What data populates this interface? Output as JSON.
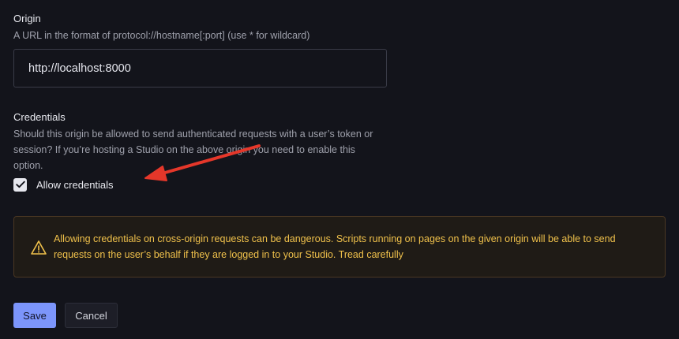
{
  "origin": {
    "label": "Origin",
    "help": "A URL in the format of protocol://hostname[:port] (use * for wildcard)",
    "value": "http://localhost:8000"
  },
  "credentials": {
    "label": "Credentials",
    "help": "Should this origin be allowed to send authenticated requests with a user’s token or session? If you’re hosting a Studio on the above origin you need to enable this option.",
    "checkbox_label": "Allow credentials",
    "checked": true
  },
  "warning": {
    "icon": "warning-triangle-icon",
    "text": "Allowing credentials on cross-origin requests can be dangerous. Scripts running on pages on the given origin will be able to send requests on the user’s behalf if they are logged in to your Studio. Tread carefully"
  },
  "actions": {
    "save_label": "Save",
    "cancel_label": "Cancel"
  },
  "colors": {
    "background": "#13141b",
    "accent": "#7c95fb",
    "warning_text": "#f0c14b",
    "annotation_arrow": "#e5372a"
  }
}
